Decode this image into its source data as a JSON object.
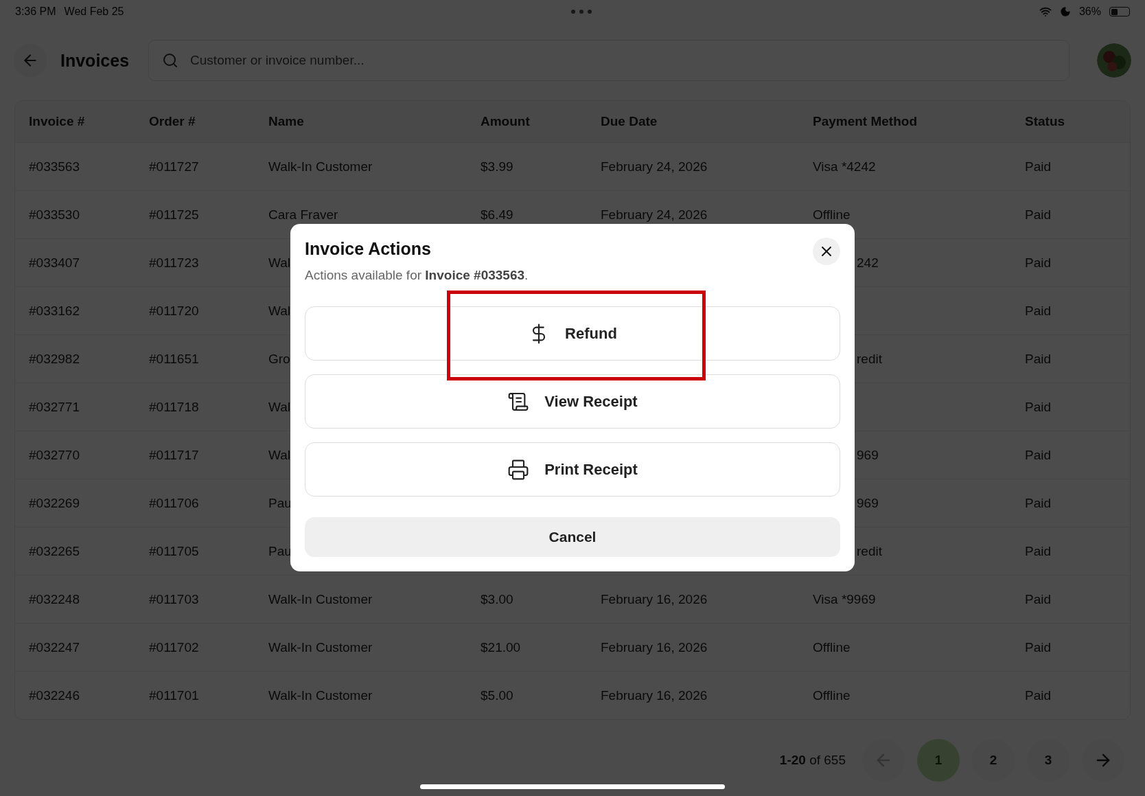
{
  "status_bar": {
    "time": "3:36 PM",
    "date": "Wed Feb 25",
    "battery": "36%"
  },
  "header": {
    "title": "Invoices",
    "search": {
      "placeholder": "Customer or invoice number..."
    }
  },
  "table": {
    "columns": [
      "Invoice #",
      "Order #",
      "Name",
      "Amount",
      "Due Date",
      "Payment Method",
      "Status"
    ],
    "rows": [
      {
        "invoice": "#033563",
        "order": "#011727",
        "name": "Walk-In Customer",
        "amount": "$3.99",
        "due": "February 24, 2026",
        "payment": "Visa *4242",
        "status": "Paid"
      },
      {
        "invoice": "#033530",
        "order": "#011725",
        "name": "Cara Fraver",
        "amount": "$6.49",
        "due": "February 24, 2026",
        "payment": "Offline",
        "status": "Paid"
      },
      {
        "invoice": "#033407",
        "order": "#011723",
        "name": "Wal",
        "payment": "242",
        "status": "Paid"
      },
      {
        "invoice": "#033162",
        "order": "#011720",
        "name": "Wal",
        "status": "Paid"
      },
      {
        "invoice": "#032982",
        "order": "#011651",
        "name": "Gro",
        "payment": "redit",
        "status": "Paid"
      },
      {
        "invoice": "#032771",
        "order": "#011718",
        "name": "Wal",
        "status": "Paid"
      },
      {
        "invoice": "#032770",
        "order": "#011717",
        "name": "Wal",
        "payment": "969",
        "status": "Paid"
      },
      {
        "invoice": "#032269",
        "order": "#011706",
        "name": "Pau",
        "payment": "969",
        "status": "Paid"
      },
      {
        "invoice": "#032265",
        "order": "#011705",
        "name": "Pau",
        "payment": "redit",
        "status": "Paid"
      },
      {
        "invoice": "#032248",
        "order": "#011703",
        "name": "Walk-In Customer",
        "amount": "$3.00",
        "due": "February 16, 2026",
        "payment": "Visa *9969",
        "status": "Paid"
      },
      {
        "invoice": "#032247",
        "order": "#011702",
        "name": "Walk-In Customer",
        "amount": "$21.00",
        "due": "February 16, 2026",
        "payment": "Offline",
        "status": "Paid"
      },
      {
        "invoice": "#032246",
        "order": "#011701",
        "name": "Walk-In Customer",
        "amount": "$5.00",
        "due": "February 16, 2026",
        "payment": "Offline",
        "status": "Paid"
      }
    ]
  },
  "pagination": {
    "range": "1-20",
    "total": "of 655",
    "prev_disabled": true,
    "pages": [
      {
        "label": "1",
        "selected": true
      },
      {
        "label": "2",
        "selected": false
      },
      {
        "label": "3",
        "selected": false
      }
    ]
  },
  "dialog": {
    "title": "Invoice Actions",
    "description": "Actions available for **Invoice #033563**.",
    "actions": [
      {
        "kind": "refund",
        "label": "Refund",
        "highlighted": true
      },
      {
        "kind": "view_receipt",
        "label": "View Receipt",
        "highlighted": false
      },
      {
        "kind": "print_receipt",
        "label": "Print Receipt",
        "highlighted": false
      }
    ],
    "cancel": "Cancel"
  }
}
